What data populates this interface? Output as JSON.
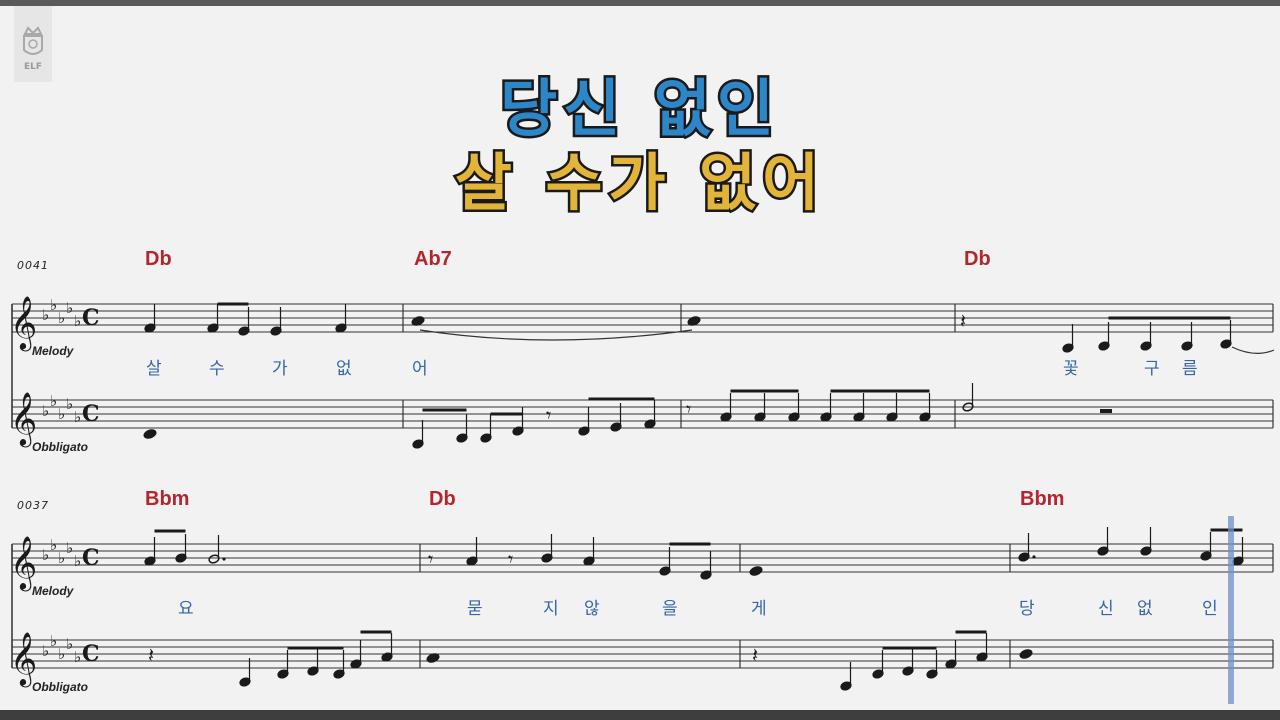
{
  "title": {
    "line1": "당신 없인",
    "line2": "살 수가 없어"
  },
  "logo": {
    "text": "ELF",
    "icon": "crest-icon"
  },
  "systems": [
    {
      "number": "0041",
      "chords": [
        "Db",
        "Ab7",
        "Db"
      ],
      "melody_label": "Melody",
      "obbligato_label": "Obbligato",
      "lyrics": [
        "살",
        "수",
        "가",
        "없",
        "어",
        "꽃",
        "구",
        "름"
      ]
    },
    {
      "number": "0037",
      "chords": [
        "Bbm",
        "Db",
        "Bbm"
      ],
      "melody_label": "Melody",
      "obbligato_label": "Obbligato",
      "lyrics": [
        "요",
        "묻",
        "지",
        "않",
        "을",
        "게",
        "당",
        "신",
        "없",
        "인"
      ]
    }
  ],
  "key_signature": "5 flats",
  "time_signature": "C",
  "colors": {
    "title_line1": "#2d86c8",
    "title_line2": "#e2b43a",
    "chord": "#b3262d",
    "lyric": "#3565a8",
    "cursor": "#6f8fc8"
  }
}
